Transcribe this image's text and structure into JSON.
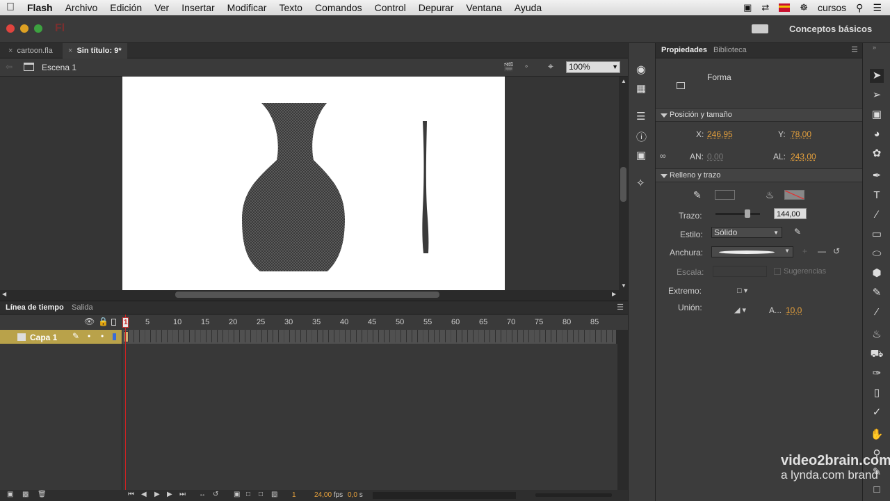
{
  "menubar": {
    "app": "Flash",
    "items": [
      "Archivo",
      "Edición",
      "Ver",
      "Insertar",
      "Modificar",
      "Texto",
      "Comandos",
      "Control",
      "Depurar",
      "Ventana",
      "Ayuda"
    ],
    "user": "cursos"
  },
  "header": {
    "app_logo": "Fl",
    "workspace": "Conceptos básicos"
  },
  "doc_tabs": [
    {
      "label": "cartoon.fla"
    },
    {
      "label": "Sin título: 9*"
    }
  ],
  "scene": {
    "label": "Escena 1",
    "zoom": "100%"
  },
  "timeline": {
    "tabs": [
      "Línea de tiempo",
      "Salida"
    ],
    "frame_numbers": [
      "1",
      "5",
      "10",
      "15",
      "20",
      "25",
      "30",
      "35",
      "40",
      "45",
      "50",
      "55",
      "60",
      "65",
      "70",
      "75",
      "80",
      "85"
    ],
    "layer_name": "Capa 1",
    "current_frame": "1",
    "fps": "24,00",
    "fps_unit": "fps",
    "time": "0,0",
    "time_unit": "s"
  },
  "properties": {
    "tabs": [
      "Propiedades",
      "Biblioteca"
    ],
    "object_type": "Forma",
    "position_size": {
      "header": "Posición y tamaño",
      "x_label": "X:",
      "x": "246,95",
      "y_label": "Y:",
      "y": "78,00",
      "w_label": "AN:",
      "w": "0,00",
      "h_label": "AL:",
      "h": "243,00"
    },
    "fill_stroke": {
      "header": "Relleno y trazo",
      "stroke_label": "Trazo:",
      "stroke_value": "144,00",
      "style_label": "Estilo:",
      "style_value": "Sólido",
      "width_label": "Anchura:",
      "scale_label": "Escala:",
      "hints_label": "Sugerencias",
      "cap_label": "Extremo:",
      "join_label": "Unión:",
      "miter_label": "A...",
      "miter_value": "10,0"
    }
  },
  "watermark": {
    "line1": "video2brain.com",
    "line2": "a lynda.com brand"
  },
  "colors": {
    "accent": "#e8a23c",
    "layer_highlight": "#b9a24a",
    "playhead": "#cc2222"
  }
}
